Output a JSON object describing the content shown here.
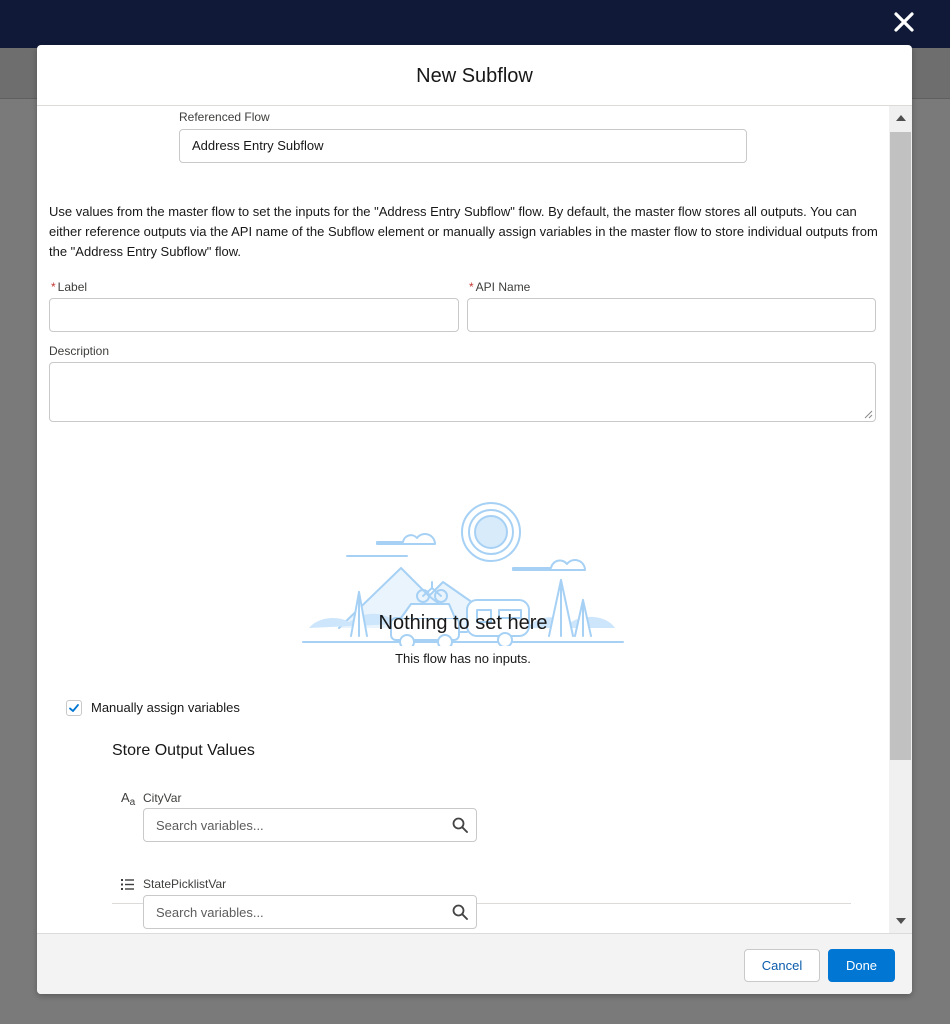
{
  "modal": {
    "title": "New Subflow"
  },
  "referenced_flow": {
    "label": "Referenced Flow",
    "value": "Address Entry Subflow"
  },
  "description_text": "Use values from the master flow to set the inputs for the \"Address Entry Subflow\" flow. By default, the master flow stores all outputs. You can either reference outputs via the API name of the Subflow element or manually assign variables in the master flow to store individual outputs from the \"Address Entry Subflow\" flow.",
  "fields": {
    "label": {
      "required_mark": "*",
      "text": "Label",
      "value": ""
    },
    "api_name": {
      "required_mark": "*",
      "text": "API Name",
      "value": ""
    },
    "description": {
      "text": "Description",
      "value": ""
    }
  },
  "empty_state": {
    "title": "Nothing to set here",
    "subtitle": "This flow has no inputs."
  },
  "manual_assign": {
    "label": "Manually assign variables",
    "checked": true
  },
  "outputs": {
    "title": "Store Output Values",
    "items": [
      {
        "type_icon": "text-type-icon",
        "icon_glyph": "Aa",
        "name": "CityVar",
        "placeholder": "Search variables..."
      },
      {
        "type_icon": "picklist-type-icon",
        "icon_glyph": "☰",
        "name": "StatePicklistVar",
        "placeholder": "Search variables..."
      }
    ]
  },
  "footer": {
    "cancel_label": "Cancel",
    "done_label": "Done"
  },
  "colors": {
    "brand": "#0176d3",
    "header_bg": "#101a38",
    "illustration": "#a6d1f5"
  }
}
